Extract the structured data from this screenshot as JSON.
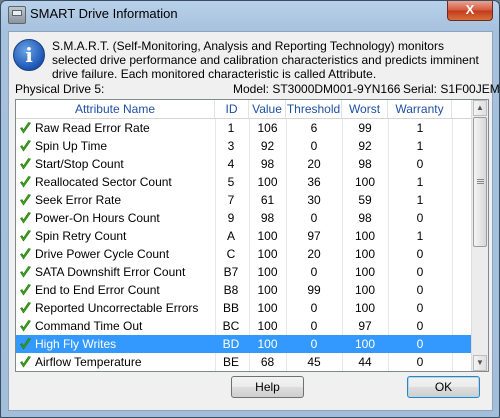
{
  "window": {
    "title": "SMART Drive Information",
    "close_label": "X"
  },
  "description": "S.M.A.R.T. (Self-Monitoring, Analysis and Reporting Technology) monitors selected drive performance and calibration characteristics and predicts imminent drive failure. Each monitored characteristic is called Attribute.",
  "drive": {
    "physical_label": "Physical Drive 5:",
    "model": "Model: ST3000DM001-9YN166",
    "serial": "Serial: S1F00JEM"
  },
  "table": {
    "columns": [
      "Attribute Name",
      "ID",
      "Value",
      "Threshold",
      "Worst",
      "Warranty"
    ],
    "rows": [
      {
        "name": "Raw Read Error Rate",
        "id": "1",
        "value": "106",
        "threshold": "6",
        "worst": "99",
        "warranty": "1"
      },
      {
        "name": "Spin Up Time",
        "id": "3",
        "value": "92",
        "threshold": "0",
        "worst": "92",
        "warranty": "1"
      },
      {
        "name": "Start/Stop Count",
        "id": "4",
        "value": "98",
        "threshold": "20",
        "worst": "98",
        "warranty": "0"
      },
      {
        "name": "Reallocated Sector Count",
        "id": "5",
        "value": "100",
        "threshold": "36",
        "worst": "100",
        "warranty": "1"
      },
      {
        "name": "Seek Error Rate",
        "id": "7",
        "value": "61",
        "threshold": "30",
        "worst": "59",
        "warranty": "1"
      },
      {
        "name": "Power-On Hours Count",
        "id": "9",
        "value": "98",
        "threshold": "0",
        "worst": "98",
        "warranty": "0"
      },
      {
        "name": "Spin Retry Count",
        "id": "A",
        "value": "100",
        "threshold": "97",
        "worst": "100",
        "warranty": "1"
      },
      {
        "name": "Drive Power Cycle Count",
        "id": "C",
        "value": "100",
        "threshold": "20",
        "worst": "100",
        "warranty": "0"
      },
      {
        "name": "SATA Downshift Error Count",
        "id": "B7",
        "value": "100",
        "threshold": "0",
        "worst": "100",
        "warranty": "0"
      },
      {
        "name": "End to End Error Count",
        "id": "B8",
        "value": "100",
        "threshold": "99",
        "worst": "100",
        "warranty": "0"
      },
      {
        "name": "Reported Uncorrectable Errors",
        "id": "BB",
        "value": "100",
        "threshold": "0",
        "worst": "100",
        "warranty": "0"
      },
      {
        "name": "Command Time Out",
        "id": "BC",
        "value": "100",
        "threshold": "0",
        "worst": "97",
        "warranty": "0"
      },
      {
        "name": "High Fly Writes",
        "id": "BD",
        "value": "100",
        "threshold": "0",
        "worst": "100",
        "warranty": "0",
        "selected": true
      },
      {
        "name": "Airflow Temperature",
        "id": "BE",
        "value": "68",
        "threshold": "45",
        "worst": "44",
        "warranty": "0"
      }
    ]
  },
  "buttons": {
    "help": "Help",
    "ok": "OK"
  },
  "colors": {
    "selection": "#3399ff",
    "header_text": "#1e50a2",
    "check": "#3aa51a"
  }
}
